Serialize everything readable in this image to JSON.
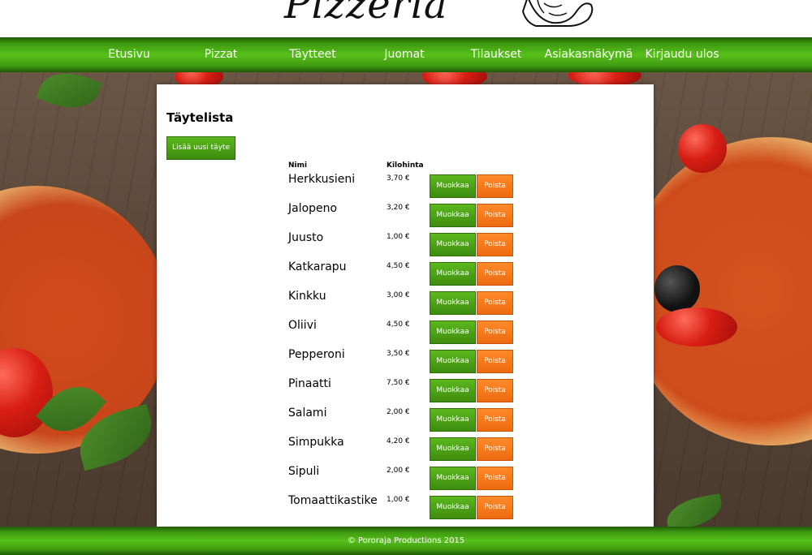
{
  "header": {
    "logo_text": "Pizzeria",
    "logo_icon": "chef-icon"
  },
  "nav": {
    "items": [
      {
        "label": "Etusivu"
      },
      {
        "label": "Pizzat"
      },
      {
        "label": "Täytteet"
      },
      {
        "label": "Juomat"
      },
      {
        "label": "Tilaukset"
      },
      {
        "label": "Asiakasnäkymä"
      },
      {
        "label": "Kirjaudu ulos"
      }
    ]
  },
  "main": {
    "title": "Täytelista",
    "add_button": "Lisää uusi täyte",
    "columns": {
      "name": "Nimi",
      "price": "Kilohinta"
    },
    "edit_label": "Muokkaa",
    "delete_label": "Poista",
    "rows": [
      {
        "name": "Herkkusieni",
        "price": "3,70 €"
      },
      {
        "name": "Jalopeno",
        "price": "3,20 €"
      },
      {
        "name": "Juusto",
        "price": "1,00 €"
      },
      {
        "name": "Katkarapu",
        "price": "4,50 €"
      },
      {
        "name": "Kinkku",
        "price": "3,00 €"
      },
      {
        "name": "Oliivi",
        "price": "4,50 €"
      },
      {
        "name": "Pepperoni",
        "price": "3,50 €"
      },
      {
        "name": "Pinaatti",
        "price": "7,50 €"
      },
      {
        "name": "Salami",
        "price": "2,00 €"
      },
      {
        "name": "Simpukka",
        "price": "4,20 €"
      },
      {
        "name": "Sipuli",
        "price": "2,00 €"
      },
      {
        "name": "Tomaattikastike",
        "price": "1,00 €"
      }
    ]
  },
  "footer": {
    "copyright": "© Pororaja Productions 2015"
  },
  "colors": {
    "nav_green": "#57c11a",
    "edit_green": "#4ea516",
    "delete_orange": "#f47a1c"
  }
}
